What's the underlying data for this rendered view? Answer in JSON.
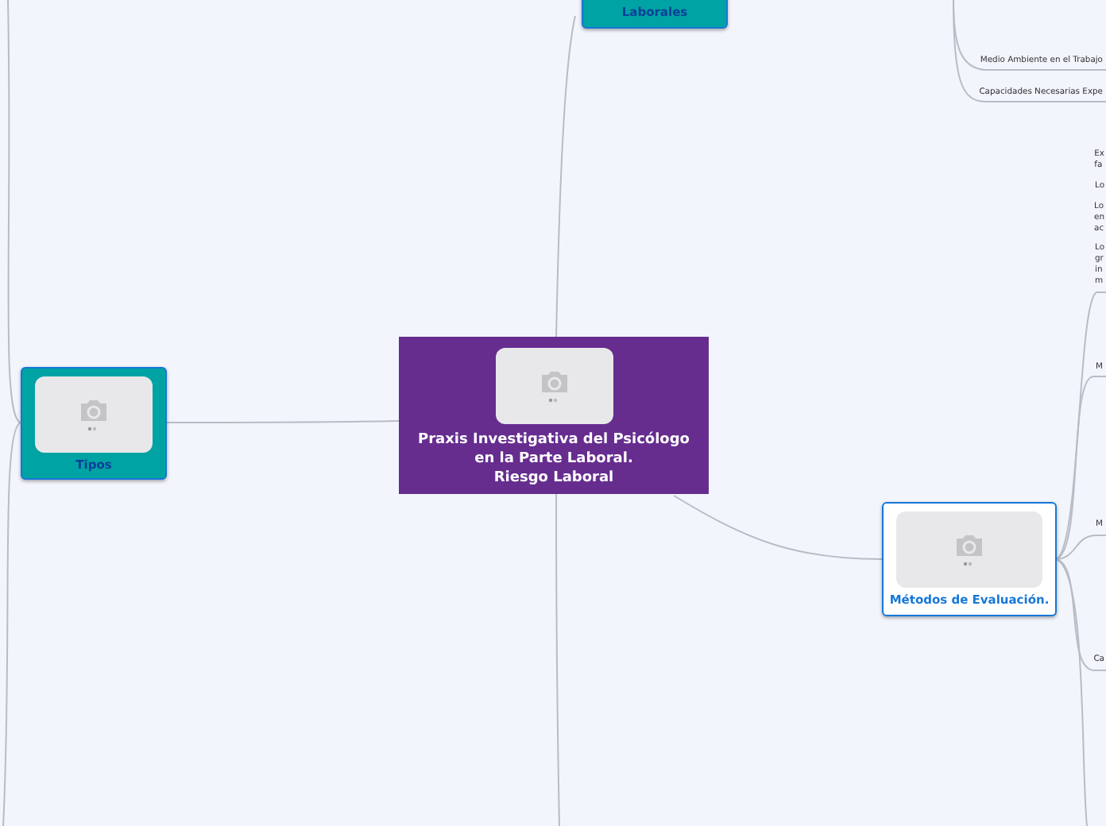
{
  "central": {
    "lines": [
      "Praxis Investigativa del Psicólogo",
      "en la Parte Laboral.",
      "Riesgo Laboral"
    ]
  },
  "topics": [
    {
      "kind": "teal",
      "label": "Laborales"
    },
    {
      "kind": "teal",
      "label": "Tipos"
    },
    {
      "kind": "white",
      "label": "Métodos de Evaluación."
    }
  ],
  "subtopics": [
    {
      "lines": [
        "Medio Ambiente en el Trabajo"
      ]
    },
    {
      "lines": [
        "Capacidades Necesarias Expe"
      ]
    },
    {
      "lines": [
        "Ex",
        "fa"
      ]
    },
    {
      "lines": [
        "Lo"
      ]
    },
    {
      "lines": [
        "Lo",
        "en",
        "ac"
      ]
    },
    {
      "lines": [
        "Lo",
        "gr",
        "in",
        "m"
      ]
    },
    {
      "lines": [
        "M"
      ]
    },
    {
      "lines": [
        "M"
      ]
    },
    {
      "lines": [
        "Ca"
      ]
    }
  ]
}
